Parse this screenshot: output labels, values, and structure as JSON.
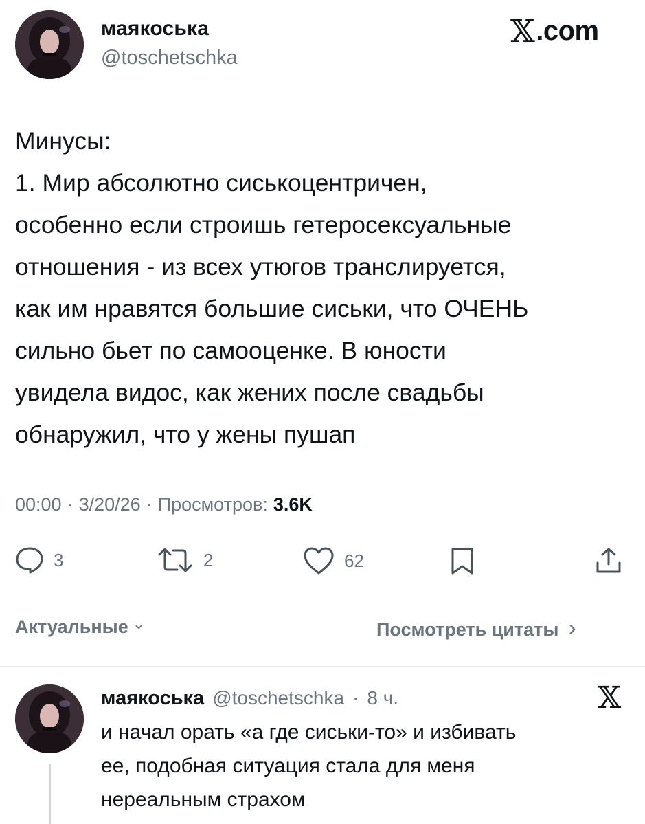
{
  "header": {
    "display_name": "маякоська",
    "handle": "@toschetschka",
    "site_label": ".com",
    "site_logo_glyph": "𝕏"
  },
  "tweet": {
    "text": "Минусы:\n1. Мир абсолютно сиськоцентричен,\nособенно если строишь гетеросексуальные\nотношения - из всех утюгов транслируется,\nкак им нравятся большие сиськи, что ОЧЕНЬ\nсильно бьет по самооценке. В юности\nувидела видос, как жених после свадьбы\nобнаружил, что у жены пушап",
    "time": "00:00",
    "sep": "·",
    "date": "3/20/26",
    "views_label": "Просмотров:",
    "views_value": "3.6K"
  },
  "actions": {
    "replies": "3",
    "retweets": "2",
    "likes": "62"
  },
  "sort": {
    "label": "Актуальные",
    "chevron": "⌄",
    "quotes_label": "Посмотреть цитаты",
    "quotes_chevron": "›"
  },
  "reply": {
    "display_name": "маякоська",
    "handle": "@toschetschka",
    "sep": "·",
    "age": "8 ч.",
    "x_glyph": "𝕏",
    "text": "и начал орать «а где сиськи-то» и избивать\nее, подобная ситуация стала для меня\nнереальным страхом"
  },
  "colors": {
    "text": "#0f1419",
    "secondary": "#6b7580",
    "divider": "#e6e9ec"
  },
  "icons": [
    "reply-icon",
    "retweet-icon",
    "like-icon",
    "bookmark-icon",
    "share-icon",
    "x-logo-icon"
  ]
}
